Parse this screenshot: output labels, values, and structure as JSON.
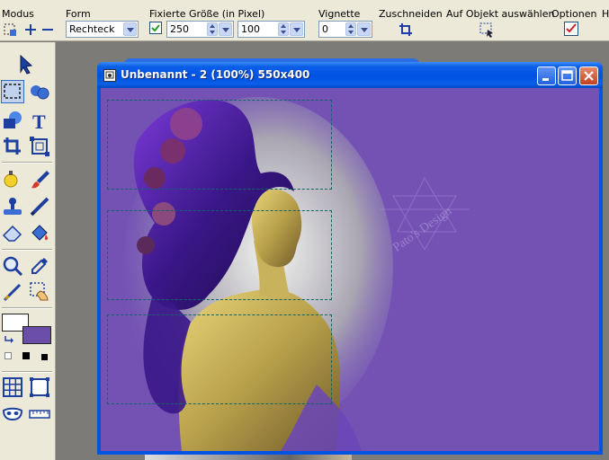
{
  "options_bar": {
    "modus_label": "Modus",
    "form_label": "Form",
    "form_value": "Rechteck",
    "fixed_size_label": "Fixierte Größe (in Pixel)",
    "width_value": "250",
    "height_value": "100",
    "vignette_label": "Vignette",
    "vignette_value": "0",
    "crop_label": "Zuschneiden",
    "select_object_label": "Auf Objekt auswählen",
    "options_label": "Optionen",
    "cut_label": "H"
  },
  "document": {
    "title": "Unbenannt - 2 (100%) 550x400",
    "watermark": "Pato's Design",
    "accent_color": "#7352b4"
  },
  "tools": [
    "pointer-tool",
    "marquee-tool",
    "lasso-tool",
    "shape-tool",
    "text-tool",
    "crop-tool",
    "transform-tool",
    "dodge-tool",
    "brush-tool",
    "stamp-tool",
    "line-tool",
    "eraser-tool",
    "fill-tool",
    "zoom-tool",
    "eyedropper-tool",
    "smudge-tool",
    "magic-wand-tool",
    "grid-tool",
    "frame-tool",
    "mask-tool",
    "ruler-tool"
  ],
  "colors": {
    "foreground": "#ffffff",
    "background": "#6b4ea8"
  }
}
